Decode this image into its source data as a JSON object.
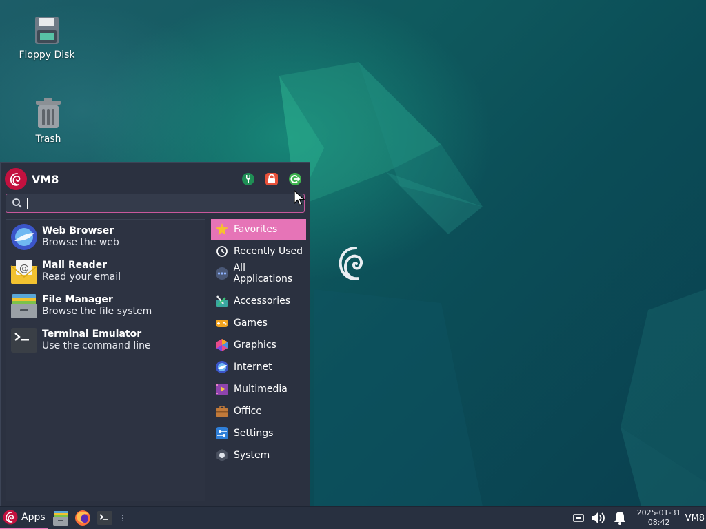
{
  "desktop": {
    "icons": [
      {
        "label": "Floppy Disk",
        "icon": "floppy-disk-icon"
      },
      {
        "label": "Trash",
        "icon": "trash-icon"
      }
    ]
  },
  "menu": {
    "username": "VM8",
    "header_actions": [
      {
        "icon": "settings-manager-icon",
        "color": "#1fa35a"
      },
      {
        "icon": "lock-screen-icon",
        "color": "#e8513a"
      },
      {
        "icon": "logout-icon",
        "color": "#3fb34f"
      }
    ],
    "search": {
      "value": "",
      "placeholder": ""
    },
    "favorites": [
      {
        "title": "Web Browser",
        "subtitle": "Browse the web",
        "icon": "web-browser-icon"
      },
      {
        "title": "Mail Reader",
        "subtitle": "Read your email",
        "icon": "mail-reader-icon"
      },
      {
        "title": "File Manager",
        "subtitle": "Browse the file system",
        "icon": "file-manager-icon"
      },
      {
        "title": "Terminal Emulator",
        "subtitle": "Use the command line",
        "icon": "terminal-icon"
      }
    ],
    "categories_top": [
      {
        "label": "Favorites",
        "icon": "star-icon",
        "active": true
      },
      {
        "label": "Recently Used",
        "icon": "clock-icon"
      },
      {
        "label": "All Applications",
        "icon": "all-apps-icon"
      }
    ],
    "categories": [
      {
        "label": "Accessories",
        "icon": "accessories-icon"
      },
      {
        "label": "Games",
        "icon": "games-icon"
      },
      {
        "label": "Graphics",
        "icon": "graphics-icon"
      },
      {
        "label": "Internet",
        "icon": "internet-icon"
      },
      {
        "label": "Multimedia",
        "icon": "multimedia-icon"
      },
      {
        "label": "Office",
        "icon": "office-icon"
      },
      {
        "label": "Settings",
        "icon": "settings-icon"
      },
      {
        "label": "System",
        "icon": "system-icon"
      }
    ],
    "accent_color": "#e674b7"
  },
  "taskbar": {
    "apps_label": "Apps",
    "launchers": [
      "file-manager-icon",
      "firefox-icon",
      "terminal-icon"
    ],
    "clock_date": "2025-01-31",
    "clock_time": "08:42",
    "hostname": "VM8"
  }
}
